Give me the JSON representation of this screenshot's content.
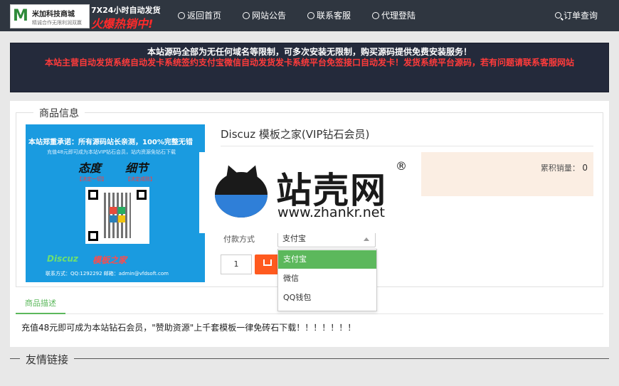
{
  "header": {
    "logo_name": "米加科技商城",
    "logo_sub": "精诚合作无限利润双赢",
    "logo_ad_line1": "7X24小时自动发货",
    "logo_ad_line2": "火爆热销中!",
    "nav": [
      {
        "label": "返回首页",
        "icon": "globe-icon"
      },
      {
        "label": "网站公告",
        "icon": "globe-icon"
      },
      {
        "label": "联系客服",
        "icon": "globe-icon"
      },
      {
        "label": "代理登陆",
        "icon": "globe-icon"
      }
    ],
    "order_query": "订单查询"
  },
  "notice": {
    "line1": "本站源码全部为无任何域名等限制，可多次安装无限制，购买源码提供免费安装服务！",
    "line2": "本站主营自动发货系统自动发卡系统签约支付宝微信自动发货发卡系统平台免签接口自动发卡！发货系统平台源码，若有问题请联系客服网站"
  },
  "product": {
    "section_title": "商品信息",
    "image_text": {
      "headline": "本站郑重承诺：所有源码站长亲测，100%完整无错",
      "sub": "充值48元即可成为本站VIP钻石会员，站内资源免钻石下载",
      "cal1": "态度",
      "cal2": "细节",
      "cal1_sub": "【决定一切】",
      "cal2_sub": "【决定成败】",
      "brand1": "Discuz",
      "brand2": "模板之家",
      "contact": "联系方式：QQ:1292292  邮箱：admin@vfdsoft.com"
    },
    "title": "Discuz 模板之家(VIP钻石会员)",
    "sales_label": "累积销量：",
    "sales_value": "0",
    "pay_label": "付款方式",
    "pay_selected": "支付宝",
    "pay_options": [
      "支付宝",
      "微信",
      "QQ钱包"
    ],
    "quantity": "1",
    "tab_desc": "商品描述",
    "description": "充值48元即可成为本站钻石会员，\"赞助资源\"上千套模板一律免砖石下载！！！！！！！"
  },
  "friends": {
    "title": "友情链接"
  },
  "watermark": {
    "name": "站壳网",
    "url": "www.zhankr.net",
    "reg": "®"
  },
  "colors": {
    "header_bg": "#2f3640",
    "notice_bg": "#242a3b",
    "accent_green": "#5cb85c",
    "buy_orange": "#ff5a1f",
    "image_blue": "#1a9be0"
  }
}
